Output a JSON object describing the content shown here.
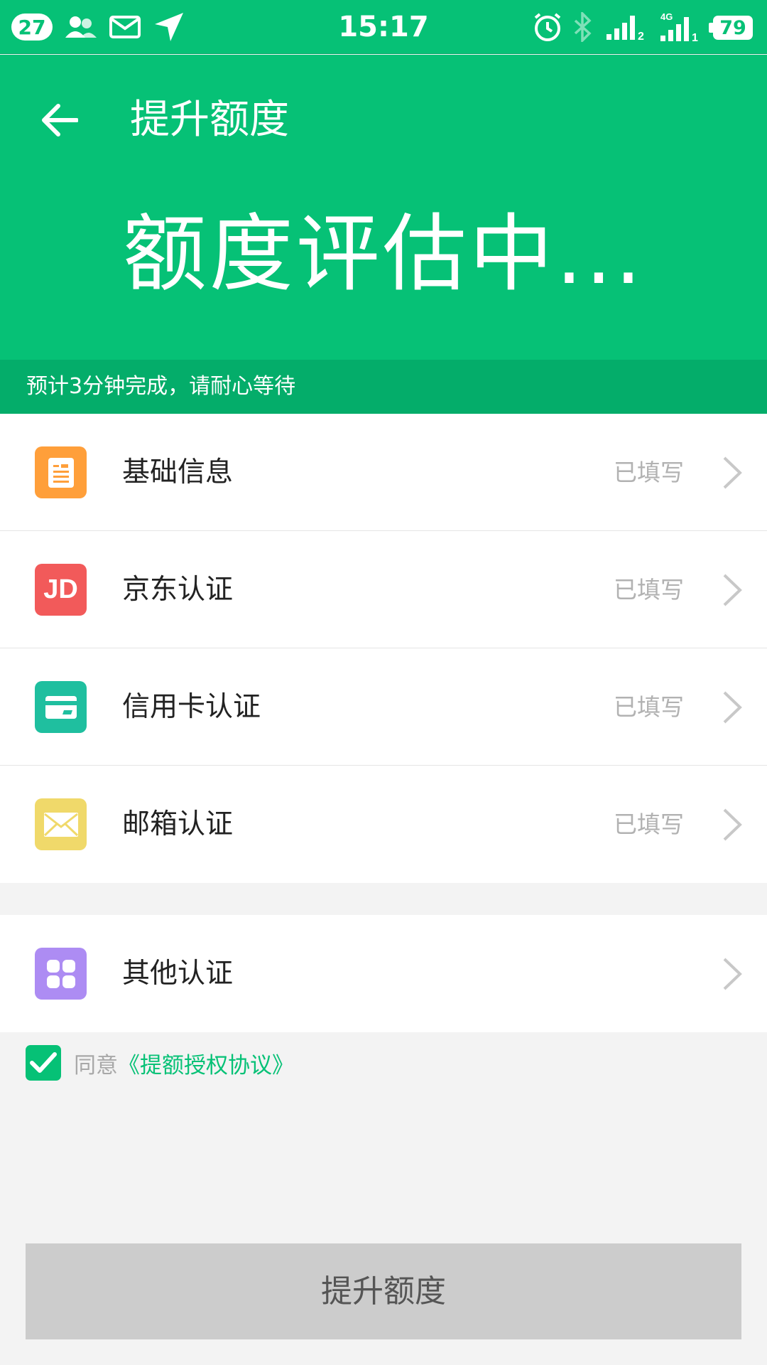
{
  "status_bar": {
    "notification_count": "27",
    "time": "15:17",
    "battery": "79",
    "network": "4G",
    "sim1": "2",
    "sim2": "1"
  },
  "header": {
    "title": "提升额度",
    "status_text": "额度评估中...",
    "estimate_text": "预计3分钟完成，请耐心等待"
  },
  "items": [
    {
      "label": "基础信息",
      "status": "已填写",
      "icon": "document-icon",
      "color": "#ff9f3a"
    },
    {
      "label": "京东认证",
      "status": "已填写",
      "icon": "jd-icon",
      "color": "#f25a5a",
      "icon_text": "JD"
    },
    {
      "label": "信用卡认证",
      "status": "已填写",
      "icon": "credit-card-icon",
      "color": "#1fbf9f"
    },
    {
      "label": "邮箱认证",
      "status": "已填写",
      "icon": "envelope-icon",
      "color": "#f0d96a"
    }
  ],
  "other": {
    "label": "其他认证",
    "icon": "grid-icon",
    "color": "#ad8cf3"
  },
  "agreement": {
    "prefix": "同意",
    "link": "《提额授权协议》",
    "checked": true
  },
  "submit_label": "提升额度",
  "colors": {
    "primary": "#06c176",
    "subbar": "#04ad6a",
    "button_disabled": "#cccccc"
  }
}
